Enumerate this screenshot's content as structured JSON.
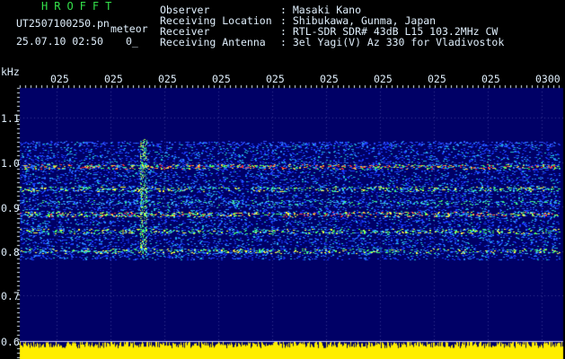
{
  "header": {
    "station": "HROFFT",
    "filename": "UT2507100250.pn",
    "file_suffix": "meteor",
    "datetime": "25.07.10 02:50",
    "counter": "0_",
    "fields": [
      {
        "label": "Observer",
        "value": ": Masaki Kano"
      },
      {
        "label": "Receiving Location",
        "value": ": Shibukawa, Gunma, Japan"
      },
      {
        "label": "Receiver",
        "value": ": RTL-SDR SDR# 43dB L15 103.2MHz CW"
      },
      {
        "label": "Receiving Antenna",
        "value": ": 3el Yagi(V) Az 330 for Vladivostok"
      }
    ]
  },
  "axis": {
    "unit": "kHz",
    "y_ticks": [
      "1.1",
      "1.0",
      "0.9",
      "0.8",
      "0.7",
      "0.6"
    ],
    "x_ticks": [
      "025",
      "025",
      "025",
      "025",
      "025",
      "025",
      "025",
      "025",
      "025",
      "0300"
    ]
  },
  "colors": {
    "background": "#000066",
    "header_text": "#dfeefb",
    "station_text": "#34e04a",
    "level_bar": "#ffee00"
  }
}
